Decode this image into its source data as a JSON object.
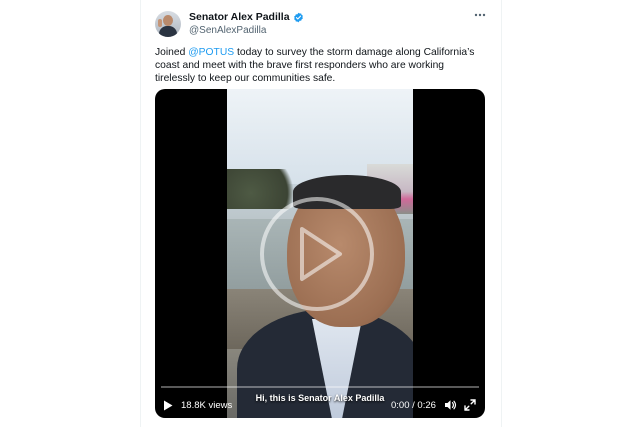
{
  "author": {
    "name": "Senator Alex Padilla",
    "handle": "@SenAlexPadilla",
    "verified": true
  },
  "tweet": {
    "text_before": "Joined ",
    "mention": "@POTUS",
    "text_after": " today to survey the storm damage along California’s coast and meet with the brave first responders who are working tirelessly to keep our communities safe."
  },
  "video": {
    "caption": "Hi, this is Senator Alex Padilla",
    "views": "18.8K views",
    "time": "0:00 / 0:26",
    "progress": 0
  },
  "colors": {
    "accent": "#1d9bf0",
    "verified": "#1d9bf0",
    "text": "#0f1419",
    "secondary": "#536471"
  },
  "icons": {
    "more": "more-horizontal-icon",
    "verified": "verified-badge-icon",
    "play": "play-icon",
    "volume": "volume-icon",
    "fullscreen": "fullscreen-icon"
  }
}
